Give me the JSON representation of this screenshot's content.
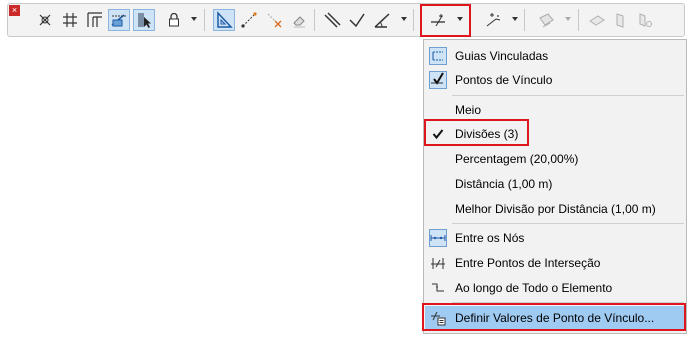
{
  "toolbar": {
    "close_label": "×",
    "tools": [
      "special-snap-icon",
      "grid-snap-icon",
      "snap-guides-icon",
      "guide-lines-icon",
      "select-arrow-icon",
      "lock-icon",
      "triangle-ruler-icon",
      "measure-line-icon",
      "delete-point-icon",
      "eraser-icon",
      "parallel-icon",
      "perpendicular-icon",
      "angle-icon",
      "snap-points-icon",
      "sparkle-cursor-icon",
      "3d-plane-icon",
      "3d-grid-icon",
      "3d-edit-icon"
    ]
  },
  "menu": {
    "items": [
      {
        "label": "Guias Vinculadas"
      },
      {
        "label": "Pontos de Vínculo"
      },
      {
        "label": "Meio"
      },
      {
        "label": "Divisões (3)"
      },
      {
        "label": "Percentagem (20,00%)"
      },
      {
        "label": "Distância (1,00 m)"
      },
      {
        "label": "Melhor Divisão por Distância (1,00 m)"
      },
      {
        "label": "Entre os Nós"
      },
      {
        "label": "Entre Pontos de Interseção"
      },
      {
        "label": "Ao longo de Todo o Elemento"
      },
      {
        "label": "Definir Valores de Ponto de Vínculo..."
      }
    ]
  },
  "colors": {
    "highlight_red": "#e0161f",
    "selection_blue": "#9fcaf2",
    "toggle_blue": "#cfe3f7"
  }
}
